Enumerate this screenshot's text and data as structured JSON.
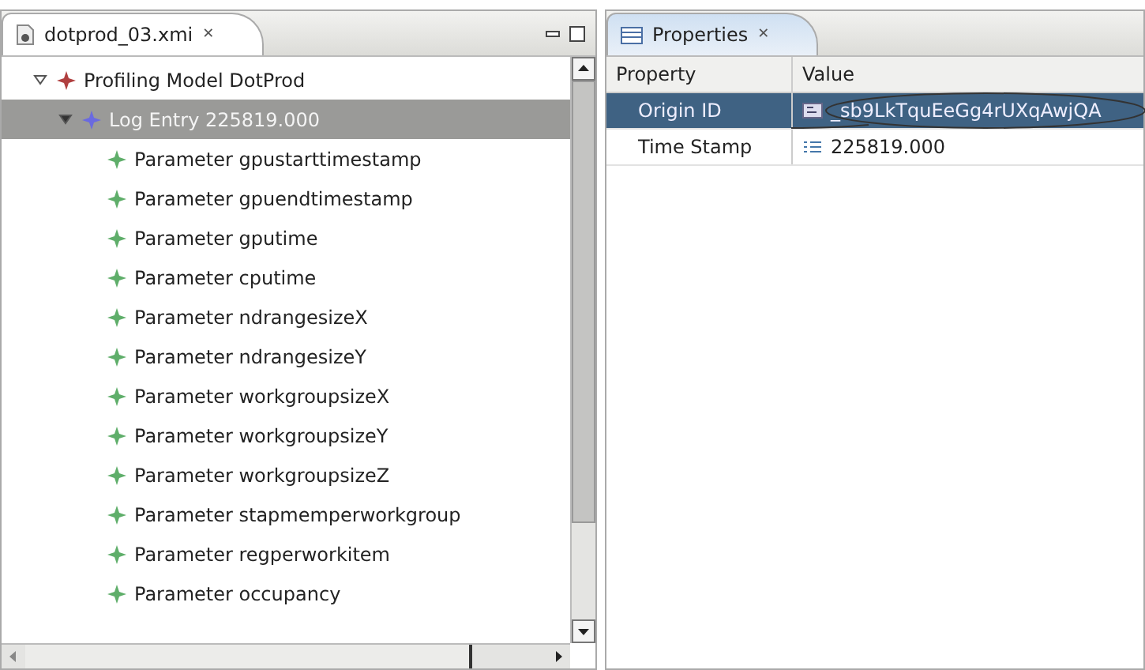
{
  "editor": {
    "tab": {
      "label": "dotprod_03.xmi",
      "close": "✕"
    },
    "tree": [
      {
        "label": "Profiling Model DotProd",
        "kind": "model",
        "expanded": true,
        "selected": false,
        "children": [
          {
            "label": "Log Entry 225819.000",
            "kind": "entry",
            "expanded": true,
            "selected": true,
            "children": [
              {
                "label": "Parameter gpustarttimestamp",
                "kind": "param",
                "selected": false
              },
              {
                "label": "Parameter gpuendtimestamp",
                "kind": "param",
                "selected": false
              },
              {
                "label": "Parameter gputime",
                "kind": "param",
                "selected": false
              },
              {
                "label": "Parameter cputime",
                "kind": "param",
                "selected": false
              },
              {
                "label": "Parameter ndrangesizeX",
                "kind": "param",
                "selected": false
              },
              {
                "label": "Parameter ndrangesizeY",
                "kind": "param",
                "selected": false
              },
              {
                "label": "Parameter workgroupsizeX",
                "kind": "param",
                "selected": false
              },
              {
                "label": "Parameter workgroupsizeY",
                "kind": "param",
                "selected": false
              },
              {
                "label": "Parameter workgroupsizeZ",
                "kind": "param",
                "selected": false
              },
              {
                "label": "Parameter stapmemperworkgroup",
                "kind": "param",
                "selected": false
              },
              {
                "label": "Parameter regperworkitem",
                "kind": "param",
                "selected": false
              },
              {
                "label": "Parameter occupancy",
                "kind": "param",
                "selected": false
              }
            ]
          }
        ]
      }
    ]
  },
  "properties": {
    "tab": {
      "label": "Properties",
      "close": "✕"
    },
    "columns": [
      "Property",
      "Value"
    ],
    "rows": [
      {
        "property": "Origin ID",
        "value": "_sb9LkTquEeGg4rUXqAwjQA",
        "kind": "id",
        "selected": true
      },
      {
        "property": "Time Stamp",
        "value": "225819.000",
        "kind": "number",
        "selected": false
      }
    ]
  }
}
